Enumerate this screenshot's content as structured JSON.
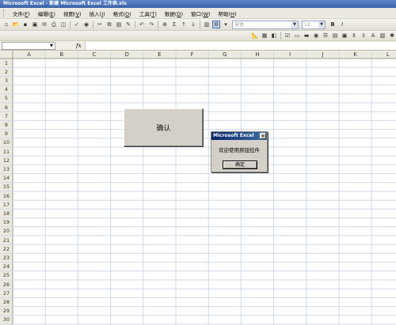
{
  "window": {
    "title": "Microsoft Excel - 新建 Microsoft Excel 工作表.xls"
  },
  "menu": [
    {
      "label": "文件",
      "key": "F"
    },
    {
      "label": "编辑",
      "key": "E"
    },
    {
      "label": "视图",
      "key": "V"
    },
    {
      "label": "插入",
      "key": "I"
    },
    {
      "label": "格式",
      "key": "O"
    },
    {
      "label": "工具",
      "key": "T"
    },
    {
      "label": "数据",
      "key": "D"
    },
    {
      "label": "窗口",
      "key": "W"
    },
    {
      "label": "帮助",
      "key": "H"
    }
  ],
  "toolbar": {
    "font_name": "宋体",
    "font_size": "12",
    "sigma_symbol": "Σ",
    "bold_glyph": "B",
    "italic_glyph": "I"
  },
  "formula_bar": {
    "fx_label": "fx",
    "name_box_value": "",
    "formula_value": ""
  },
  "sheet": {
    "columns": [
      "A",
      "B",
      "C",
      "D",
      "E",
      "F",
      "G",
      "H",
      "I",
      "J",
      "K",
      "L"
    ],
    "rows": [
      "1",
      "2",
      "3",
      "4",
      "5",
      "6",
      "7",
      "8",
      "9",
      "10",
      "11",
      "12",
      "13",
      "14",
      "15",
      "16",
      "17",
      "18",
      "19",
      "20",
      "21",
      "22",
      "23",
      "24",
      "25",
      "26",
      "27",
      "28",
      "29",
      "30"
    ]
  },
  "controls": {
    "confirm_button_label": "确认"
  },
  "message_box": {
    "title": "Microsoft Excel",
    "message": "欢迎使用按钮控件",
    "ok_label": "确定",
    "close_glyph": "✕"
  },
  "colors": {
    "title_bar": "#3a62a8",
    "dialog_title": "#0a246a",
    "button_face": "#d4d0c8",
    "grid_line": "#d0d7e5"
  }
}
